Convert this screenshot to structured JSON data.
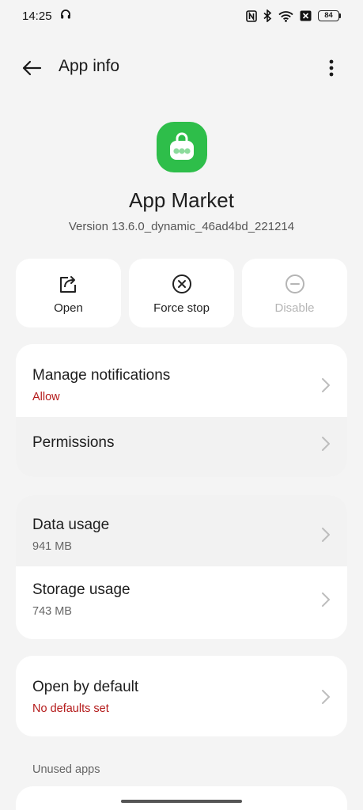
{
  "status_bar": {
    "time": "14:25",
    "battery_level": "84",
    "icons": [
      "headphones-icon",
      "nfc-icon",
      "bluetooth-icon",
      "wifi-icon",
      "no-sim-icon",
      "battery-icon"
    ]
  },
  "app_bar": {
    "title": "App info",
    "back_icon": "arrow-left-icon",
    "more_icon": "more-vert-icon"
  },
  "app": {
    "name": "App Market",
    "version": "Version 13.6.0_dynamic_46ad4bd_221214",
    "icon_color": "#2ebe4a"
  },
  "actions": [
    {
      "label": "Open",
      "icon": "open-external-icon",
      "enabled": true
    },
    {
      "label": "Force stop",
      "icon": "force-stop-icon",
      "enabled": true
    },
    {
      "label": "Disable",
      "icon": "disable-icon",
      "enabled": false
    }
  ],
  "group1": [
    {
      "title": "Manage notifications",
      "subtitle": "Allow"
    },
    {
      "title": "Permissions"
    }
  ],
  "group2": [
    {
      "title": "Data usage",
      "subtitle": "941 MB"
    },
    {
      "title": "Storage usage",
      "subtitle": "743 MB"
    }
  ],
  "group3": [
    {
      "title": "Open by default",
      "subtitle": "No defaults set"
    }
  ],
  "sections": {
    "unused_apps": "Unused apps"
  },
  "colors": {
    "background": "#f4f4f4",
    "card": "#ffffff",
    "accent_red": "#b41a1a",
    "disabled_text": "#b5b5b5"
  }
}
